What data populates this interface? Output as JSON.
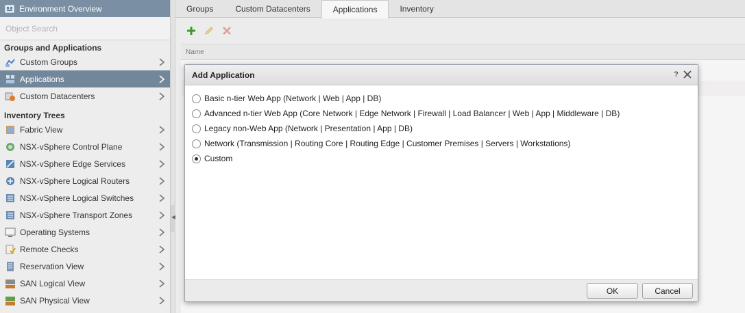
{
  "sidebar": {
    "header": "Environment Overview",
    "search_placeholder": "Object Search",
    "sections": [
      {
        "title": "Groups and Applications",
        "items": [
          {
            "label": "Custom Groups",
            "icon": "custom-groups-icon"
          },
          {
            "label": "Applications",
            "icon": "applications-icon",
            "active": true
          },
          {
            "label": "Custom Datacenters",
            "icon": "custom-datacenters-icon"
          }
        ]
      },
      {
        "title": "Inventory Trees",
        "items": [
          {
            "label": "Fabric View",
            "icon": "fabric-view-icon"
          },
          {
            "label": "NSX-vSphere Control Plane",
            "icon": "control-plane-icon"
          },
          {
            "label": "NSX-vSphere Edge Services",
            "icon": "edge-services-icon"
          },
          {
            "label": "NSX-vSphere Logical Routers",
            "icon": "logical-routers-icon"
          },
          {
            "label": "NSX-vSphere Logical Switches",
            "icon": "logical-switches-icon"
          },
          {
            "label": "NSX-vSphere Transport Zones",
            "icon": "transport-zones-icon"
          },
          {
            "label": "Operating Systems",
            "icon": "operating-systems-icon"
          },
          {
            "label": "Remote Checks",
            "icon": "remote-checks-icon"
          },
          {
            "label": "Reservation View",
            "icon": "reservation-view-icon"
          },
          {
            "label": "SAN Logical View",
            "icon": "san-logical-icon"
          },
          {
            "label": "SAN Physical View",
            "icon": "san-physical-icon"
          }
        ]
      }
    ]
  },
  "tabs": [
    {
      "label": "Groups"
    },
    {
      "label": "Custom Datacenters"
    },
    {
      "label": "Applications",
      "active": true
    },
    {
      "label": "Inventory"
    }
  ],
  "toolbar": {
    "add_icon": "plus-icon",
    "edit_icon": "pencil-icon",
    "delete_icon": "x-icon"
  },
  "grid": {
    "column_name": "Name"
  },
  "dialog": {
    "title": "Add Application",
    "help": "?",
    "options": [
      {
        "label": "Basic n-tier Web App (Network | Web | App | DB)",
        "selected": false
      },
      {
        "label": "Advanced n-tier Web App (Core Network | Edge Network | Firewall | Load Balancer | Web | App | Middleware | DB)",
        "selected": false
      },
      {
        "label": "Legacy non-Web App (Network | Presentation | App | DB)",
        "selected": false
      },
      {
        "label": "Network (Transmission | Routing Core | Routing Edge | Customer Premises | Servers | Workstations)",
        "selected": false
      },
      {
        "label": "Custom",
        "selected": true
      }
    ],
    "ok_label": "OK",
    "cancel_label": "Cancel"
  },
  "colors": {
    "sidebar_active": "#73879b",
    "header": "#7a8fa3",
    "add_green": "#3a9a2a",
    "delete_red": "#d9534f"
  }
}
